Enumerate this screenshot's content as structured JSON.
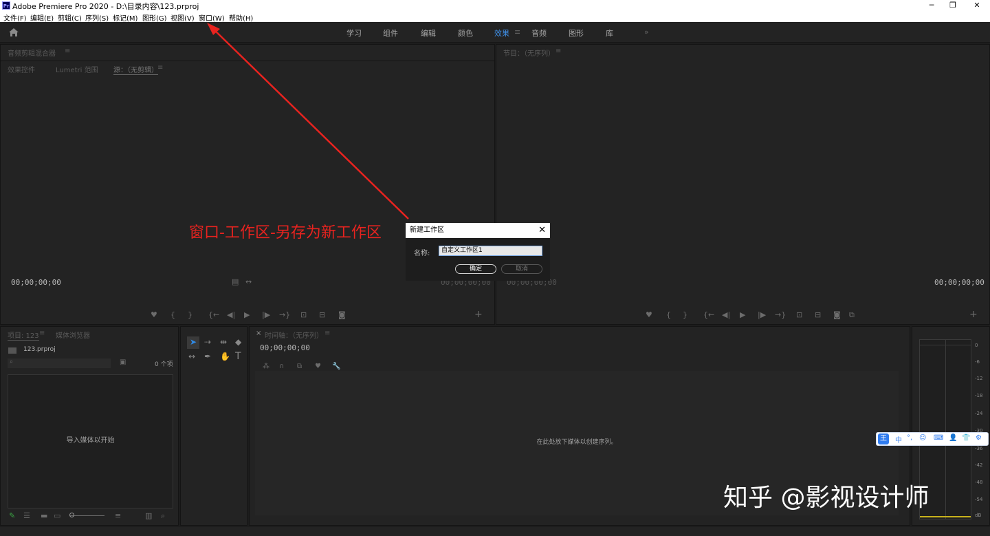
{
  "window": {
    "title": "Adobe Premiere Pro 2020 - D:\\目录内容\\123.prproj",
    "logo": "Pr",
    "minimize": "─",
    "maximize": "❐",
    "close": "✕"
  },
  "menu": [
    "文件(F)",
    "编辑(E)",
    "剪辑(C)",
    "序列(S)",
    "标记(M)",
    "图形(G)",
    "视图(V)",
    "窗口(W)",
    "帮助(H)"
  ],
  "workspaces": {
    "tabs": [
      "学习",
      "组件",
      "编辑",
      "颜色",
      "效果",
      "音频",
      "图形",
      "库"
    ],
    "active": "效果",
    "more": "»"
  },
  "source_panel": {
    "title": "音频剪辑混合器",
    "tabs": [
      "效果控件",
      "Lumetri 范围",
      "源：（无剪辑）"
    ],
    "timecode_left": "00;00;00;00",
    "timecode_right": "00;00;00;00"
  },
  "program_panel": {
    "title": "节目：（无序列）",
    "timecode_left": "00;00;00;00",
    "timecode_right": "00;00;00;00"
  },
  "project_panel": {
    "tabs": [
      "项目: 123",
      "媒体浏览器"
    ],
    "file": "123.prproj",
    "count": "0 个项",
    "empty_text": "导入媒体以开始"
  },
  "timeline_panel": {
    "close": "×",
    "title": "时间轴：（无序列）",
    "timecode": "00;00;00;00",
    "empty_text": "在此处放下媒体以创建序列。"
  },
  "meter_ticks": [
    "0",
    "-6",
    "-12",
    "-18",
    "-24",
    "-30",
    "-36",
    "-42",
    "-48",
    "-54",
    "dB"
  ],
  "dialog": {
    "title": "新建工作区",
    "close": "✕",
    "name_label": "名称:",
    "name_value": "自定义工作区1",
    "ok": "确定",
    "cancel": "取消"
  },
  "annotation": "窗口-工作区-另存为新工作区",
  "watermark": "知乎 @影视设计师",
  "ime": {
    "logo": "王",
    "items": [
      "中",
      "°,",
      "☺",
      "⌨",
      "👤",
      "👕",
      "⚙"
    ]
  },
  "colors": {
    "accent": "#3f8fe6",
    "annotation_red": "#e8231f"
  }
}
